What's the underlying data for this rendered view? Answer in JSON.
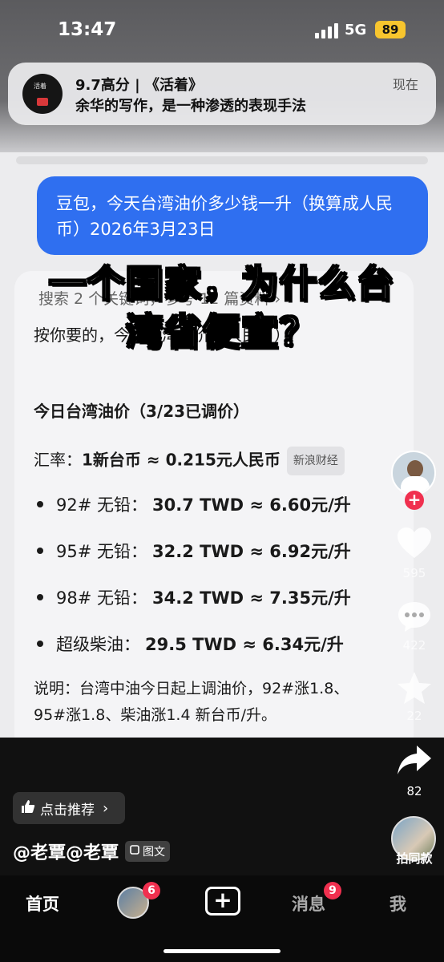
{
  "status_bar": {
    "time": "13:47",
    "network": "5G",
    "battery": "89"
  },
  "notification": {
    "title": "9.7高分 | 《活着》",
    "body": "余华的写作，是一种渗透的表现手法",
    "time": "现在",
    "avatar_text": "活着"
  },
  "chat": {
    "user_message": "豆包，今天台湾油价多少钱一升（换算成人民币）2026年3月23日",
    "search_line": "搜索 2 个关键词，参考 12 篇资料 ›",
    "intro": "按你要的，今天台湾油价（人民币）：",
    "intro_tail": "币）：",
    "heading": "今日台湾油价（3/23已调价）",
    "rate_label": "汇率：",
    "rate_value": "1新台币 ≈ 0.215元人民币",
    "rate_source": "新浪财经",
    "items": [
      {
        "name": "92# 无铅：",
        "value": "30.7 TWD ≈ 6.60元/升"
      },
      {
        "name": "95# 无铅：",
        "value": "32.2 TWD ≈ 6.92元/升"
      },
      {
        "name": "98# 无铅：",
        "value": "34.2 TWD ≈ 7.35元/升"
      },
      {
        "name": "超级柴油：",
        "value": "29.5 TWD ≈ 6.34元/升"
      }
    ],
    "note_line1": "说明：台湾中油今日起上调油价，92#涨1.8、",
    "note_line2": "95#涨1.8、柴油涨1.4 新台币/升。"
  },
  "overlay": {
    "line1": "一个国家，为什么台",
    "line2": "湾省便宜？"
  },
  "rail": {
    "likes": "595",
    "comments": "422",
    "favorites": "22",
    "shares": "82",
    "same_label": "拍同款"
  },
  "info": {
    "recommend": "点击推荐",
    "author": "@老覃@老覃",
    "tag": "图文"
  },
  "nav": {
    "home": "首页",
    "friends_badge": "6",
    "messages": "消息",
    "messages_badge": "9",
    "me": "我"
  },
  "colors": {
    "bubble": "#2f6ff0",
    "badge": "#f0304f",
    "battery": "#f7c52e"
  }
}
